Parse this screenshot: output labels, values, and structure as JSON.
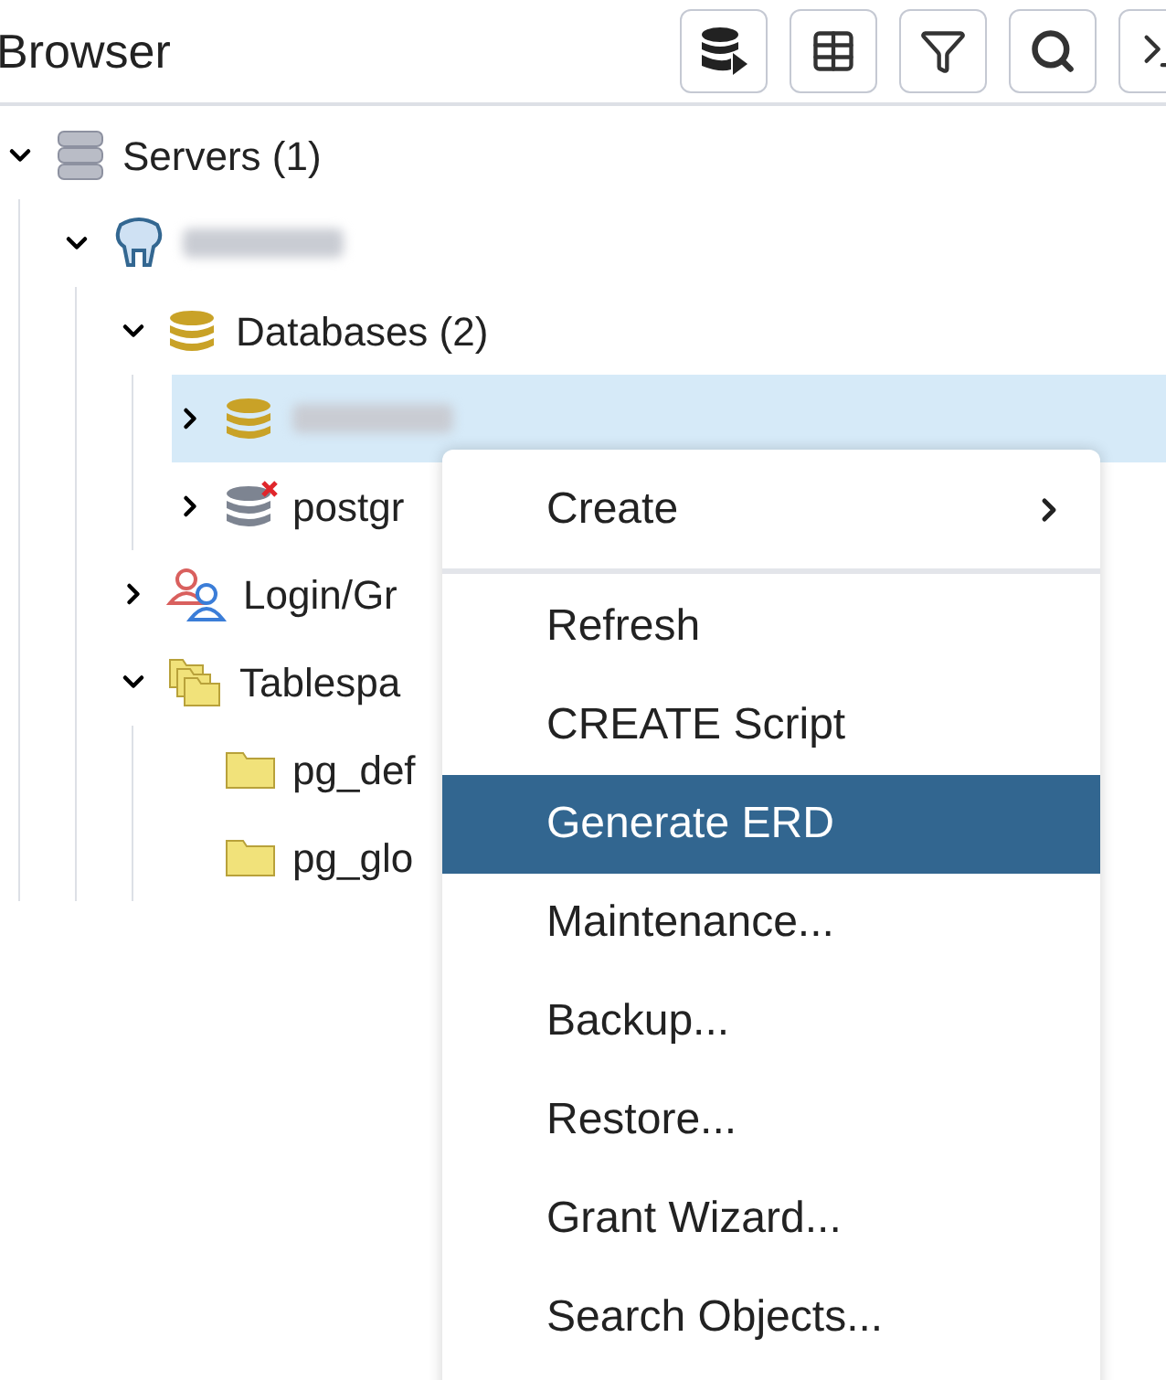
{
  "panel": {
    "title": "Browser"
  },
  "tree": [
    {
      "kind": "servers",
      "label": "Servers (1)",
      "expanded": true,
      "selected": false,
      "children": [
        {
          "kind": "server",
          "redacted": true,
          "expanded": true,
          "selected": false,
          "children": [
            {
              "kind": "databases",
              "label": "Databases (2)",
              "expanded": true,
              "selected": false,
              "children": [
                {
                  "kind": "database",
                  "redacted": true,
                  "expanded": false,
                  "selected": true
                },
                {
                  "kind": "database-disconnected",
                  "label": "postgr",
                  "expanded": false,
                  "selected": false
                }
              ]
            },
            {
              "kind": "roles",
              "label": "Login/Gr",
              "expanded": false,
              "selected": false
            },
            {
              "kind": "tablespaces",
              "label": "Tablespa",
              "expanded": true,
              "selected": false,
              "children": [
                {
                  "kind": "tablespace",
                  "label": "pg_def",
                  "selected": false
                },
                {
                  "kind": "tablespace",
                  "label": "pg_glo",
                  "selected": false
                }
              ]
            }
          ]
        }
      ]
    }
  ],
  "context_menu": {
    "items": [
      {
        "kind": "submenu",
        "label": "Create",
        "selected": false
      },
      {
        "kind": "separator"
      },
      {
        "kind": "item",
        "label": "Refresh",
        "selected": false
      },
      {
        "kind": "item",
        "label": "CREATE Script",
        "selected": false
      },
      {
        "kind": "item",
        "label": "Generate ERD",
        "selected": true
      },
      {
        "kind": "item",
        "label": "Maintenance...",
        "selected": false
      },
      {
        "kind": "item",
        "label": "Backup...",
        "selected": false
      },
      {
        "kind": "item",
        "label": "Restore...",
        "selected": false
      },
      {
        "kind": "item",
        "label": "Grant Wizard...",
        "selected": false
      },
      {
        "kind": "item",
        "label": "Search Objects...",
        "selected": false
      }
    ]
  }
}
